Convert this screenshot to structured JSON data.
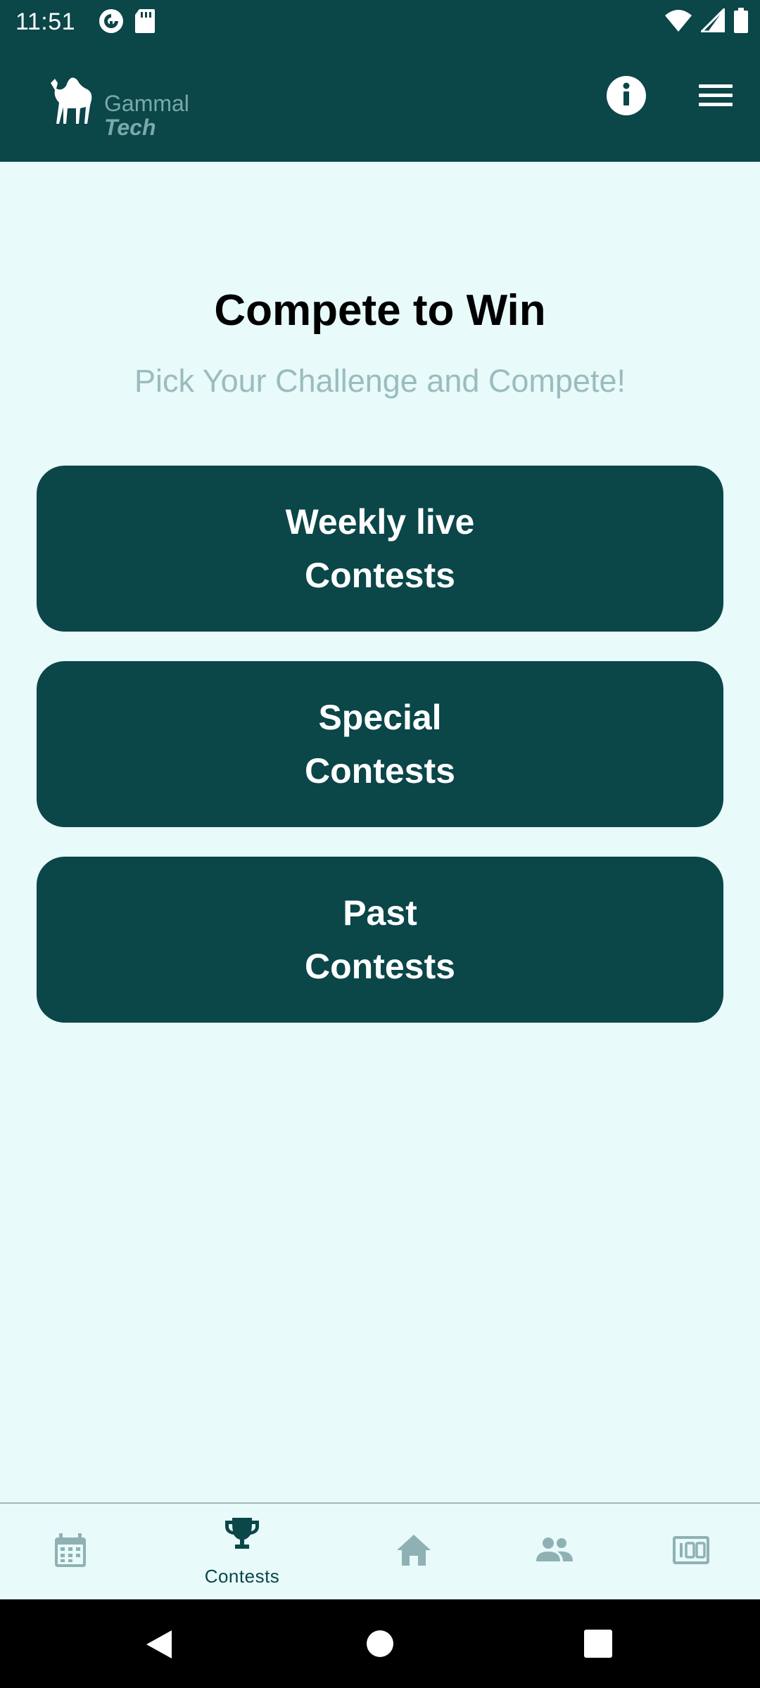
{
  "status_bar": {
    "time": "11:51",
    "left_icons": [
      "pocket-casts-icon",
      "sd-card-icon"
    ],
    "right_icons": [
      "wifi-icon",
      "signal-icon",
      "battery-icon"
    ]
  },
  "app_bar": {
    "logo": {
      "word1": "Gammal",
      "word2": "Tech",
      "icon": "camel-icon"
    },
    "info_icon": "info-icon",
    "menu_icon": "hamburger-menu-icon"
  },
  "main": {
    "title": "Compete to Win",
    "subtitle": "Pick Your Challenge and Compete!",
    "contests": [
      {
        "line1": "Weekly live",
        "line2": "Contests"
      },
      {
        "line1": "Special",
        "line2": "Contests"
      },
      {
        "line1": "Past",
        "line2": "Contests"
      }
    ]
  },
  "bottom_nav": {
    "items": [
      {
        "icon": "calendar-icon",
        "label": ""
      },
      {
        "icon": "trophy-icon",
        "label": "Contests",
        "selected": true
      },
      {
        "icon": "home-icon",
        "label": ""
      },
      {
        "icon": "group-icon",
        "label": ""
      },
      {
        "icon": "scoreboard-icon",
        "label": ""
      }
    ]
  },
  "system_nav": {
    "buttons": [
      "back-icon",
      "home-circle-icon",
      "recents-icon"
    ]
  },
  "colors": {
    "primary": "#0b4649",
    "background": "#e8fafa",
    "subtitle": "#9bbcbf",
    "nav_inactive": "#8fb1b3"
  }
}
